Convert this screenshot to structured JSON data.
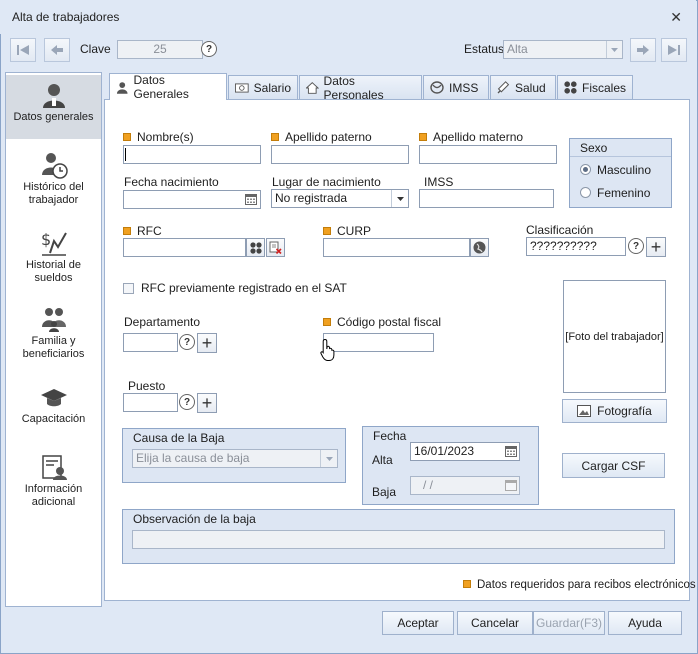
{
  "window": {
    "title": "Alta de trabajadores"
  },
  "toolbar": {
    "clave_label": "Clave",
    "clave_value": "25",
    "estatus_label": "Estatus",
    "estatus_value": "Alta"
  },
  "sidebar": {
    "items": [
      {
        "label": "Datos generales",
        "icon": "person-icon"
      },
      {
        "label": "Histórico del trabajador",
        "icon": "person-clock-icon"
      },
      {
        "label": "Historial de sueldos",
        "icon": "money-chart-icon"
      },
      {
        "label": "Familia y beneficiarios",
        "icon": "family-icon"
      },
      {
        "label": "Capacitación",
        "icon": "graduation-cap-icon"
      },
      {
        "label": "Información adicional",
        "icon": "id-card-icon"
      }
    ]
  },
  "tabs": [
    {
      "label": "Datos Generales",
      "icon": "person-icon"
    },
    {
      "label": "Salario",
      "icon": "money-icon"
    },
    {
      "label": "Datos Personales",
      "icon": "house-icon"
    },
    {
      "label": "IMSS",
      "icon": "imss-icon"
    },
    {
      "label": "Salud",
      "icon": "syringe-icon"
    },
    {
      "label": "Fiscales",
      "icon": "grid-icon"
    }
  ],
  "form": {
    "nombre_label": "Nombre(s)",
    "nombre_value": "",
    "apellido_paterno_label": "Apellido paterno",
    "apellido_paterno_value": "",
    "apellido_materno_label": "Apellido materno",
    "apellido_materno_value": "",
    "sexo_title": "Sexo",
    "sexo_masculino": "Masculino",
    "sexo_femenino": "Femenino",
    "fecha_nacimiento_label": "Fecha nacimiento",
    "fecha_nacimiento_value": "",
    "lugar_nacimiento_label": "Lugar de nacimiento",
    "lugar_nacimiento_value": "No registrada",
    "imss_label": "IMSS",
    "imss_value": "",
    "rfc_label": "RFC",
    "rfc_value": "",
    "curp_label": "CURP",
    "curp_value": "",
    "clasificacion_label": "Clasificación",
    "clasificacion_value": "??????????",
    "rfc_sat_label": "RFC previamente registrado en el SAT",
    "departamento_label": "Departamento",
    "departamento_value": "",
    "codigo_postal_label": "Código postal fiscal",
    "codigo_postal_value": "",
    "puesto_label": "Puesto",
    "puesto_value": "",
    "foto_placeholder": "[Foto del trabajador]",
    "fotografia_button": "Fotografía",
    "cargar_csf_button": "Cargar CSF",
    "causa_baja_title": "Causa de la Baja",
    "causa_baja_placeholder": "Elija la causa de baja",
    "fecha_title": "Fecha",
    "alta_label": "Alta",
    "alta_value": "16/01/2023",
    "baja_label": "Baja",
    "baja_value": "/ /",
    "observacion_title": "Observación de la baja",
    "observacion_value": "",
    "legend_text": "Datos requeridos para recibos electrónicos"
  },
  "footer": {
    "aceptar": "Aceptar",
    "cancelar": "Cancelar",
    "guardar": "Guardar(F3)",
    "ayuda": "Ayuda"
  },
  "colors": {
    "required_marker": "#f0a020",
    "window_bg": "#dfe8f5",
    "panel_border": "#9fb3d1"
  }
}
